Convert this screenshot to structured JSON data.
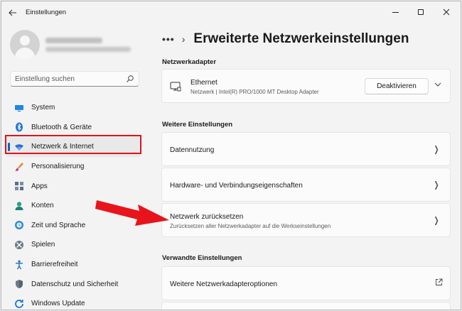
{
  "window": {
    "title": "Einstellungen"
  },
  "sidebar": {
    "search_placeholder": "Einstellung suchen",
    "items": [
      {
        "label": "System",
        "icon": "monitor-icon"
      },
      {
        "label": "Bluetooth & Geräte",
        "icon": "bluetooth-icon"
      },
      {
        "label": "Netzwerk & Internet",
        "icon": "wifi-icon",
        "active": true
      },
      {
        "label": "Personalisierung",
        "icon": "brush-icon"
      },
      {
        "label": "Apps",
        "icon": "apps-icon"
      },
      {
        "label": "Konten",
        "icon": "person-icon"
      },
      {
        "label": "Zeit und Sprache",
        "icon": "globe-clock-icon"
      },
      {
        "label": "Spielen",
        "icon": "xbox-icon"
      },
      {
        "label": "Barrierefreiheit",
        "icon": "accessibility-icon"
      },
      {
        "label": "Datenschutz und Sicherheit",
        "icon": "shield-icon"
      },
      {
        "label": "Windows Update",
        "icon": "update-icon"
      }
    ]
  },
  "main": {
    "breadcrumb_more": "•••",
    "breadcrumb_sep": "›",
    "title": "Erweiterte Netzwerkeinstellungen",
    "adapter_section": {
      "label": "Netzwerkadapter",
      "adapter": {
        "name": "Ethernet",
        "description": "Netzwerk | Intel(R) PRO/1000 MT Desktop Adapter",
        "button": "Deaktivieren"
      }
    },
    "more_section": {
      "label": "Weitere Einstellungen",
      "items": [
        {
          "title": "Datennutzung"
        },
        {
          "title": "Hardware- und Verbindungseigenschaften"
        },
        {
          "title": "Netzwerk zurücksetzen",
          "subtitle": "Zurücksetzen aller Netzwerkadapter auf die Werkseinstellungen"
        }
      ]
    },
    "related_section": {
      "label": "Verwandte Einstellungen",
      "items": [
        {
          "title": "Weitere Netzwerkadapteroptionen"
        }
      ]
    }
  },
  "colors": {
    "accent": "#0067c0",
    "highlight": "#e0121b",
    "annotation_arrow": "#e8141c"
  }
}
